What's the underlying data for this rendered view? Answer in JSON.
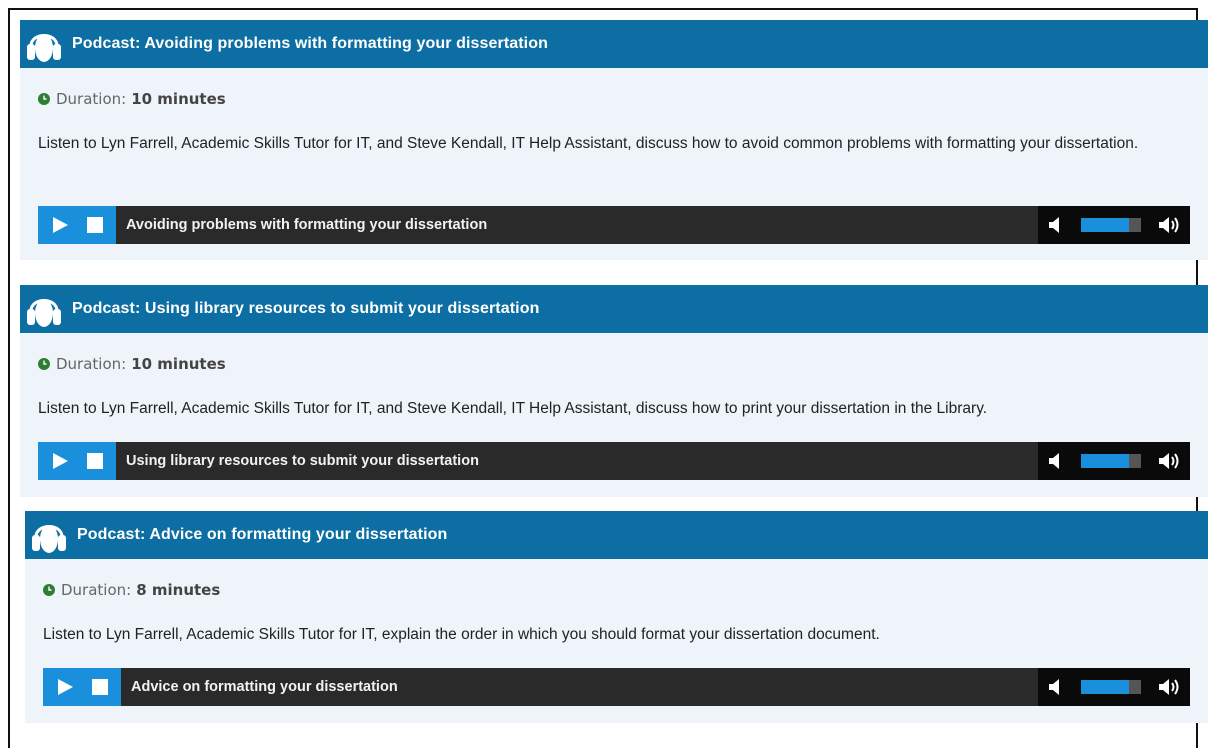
{
  "podcasts": [
    {
      "title": "Podcast: Avoiding problems with formatting your dissertation",
      "duration_label": "Duration:",
      "duration_value": "10 minutes",
      "description": "Listen to Lyn Farrell, Academic Skills Tutor for IT, and Steve Kendall, IT Help Assistant, discuss how to avoid common problems with formatting your dissertation.",
      "player_title": "Avoiding problems with formatting your dissertation",
      "volume_level": 0.8
    },
    {
      "title": "Podcast: Using library resources to submit your dissertation",
      "duration_label": "Duration:",
      "duration_value": "10 minutes",
      "description": "Listen to Lyn Farrell, Academic Skills Tutor for IT, and Steve Kendall, IT Help Assistant, discuss how to print your dissertation in the Library.",
      "player_title": "Using library resources to submit your dissertation",
      "volume_level": 0.8
    },
    {
      "title": "Podcast: Advice on formatting your dissertation",
      "duration_label": "Duration:",
      "duration_value": "8 minutes",
      "description": "Listen to Lyn Farrell, Academic Skills Tutor for IT, explain the order in which you should format your dissertation document.",
      "player_title": "Advice on formatting your dissertation",
      "volume_level": 0.8
    }
  ],
  "icons": {
    "header": "headphones-icon",
    "duration": "clock-icon",
    "play": "play-icon",
    "stop": "stop-icon",
    "mute": "speaker-mute-icon",
    "max_volume": "speaker-loud-icon"
  },
  "colors": {
    "header_bg": "#0c6ea2",
    "card_bg": "#eef4f9",
    "player_bg": "#2a2a2a",
    "player_accent": "#1a8fdb",
    "duration_icon": "#2e7d32"
  }
}
